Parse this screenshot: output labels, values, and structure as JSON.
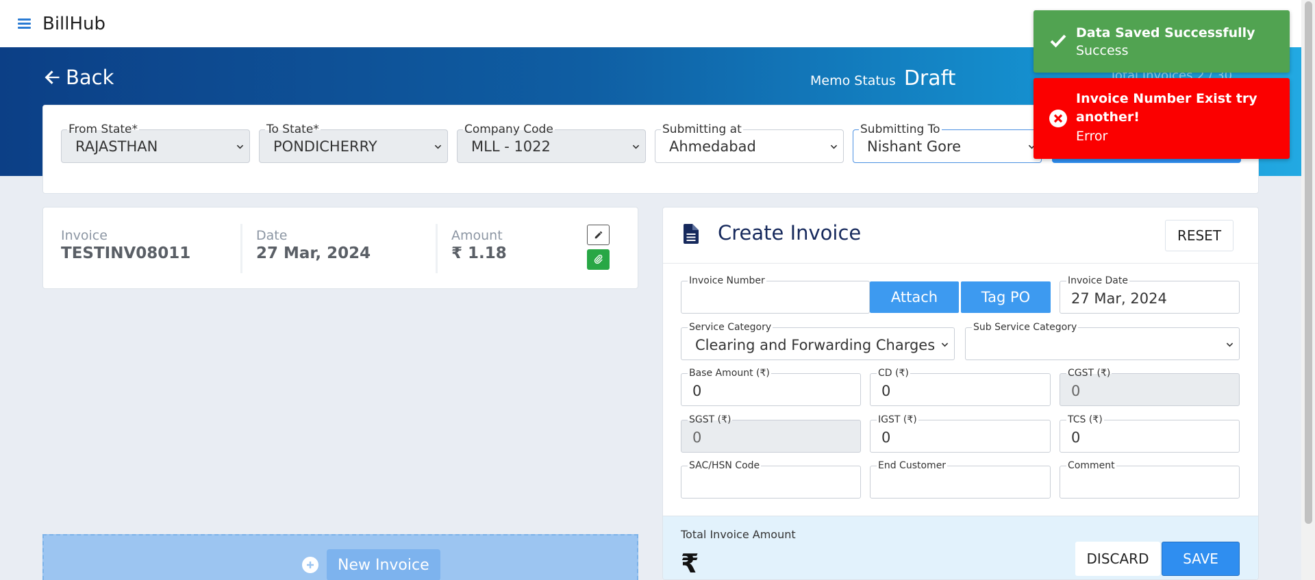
{
  "app": {
    "brand": "BillHub"
  },
  "banner": {
    "back_label": "Back",
    "memo_status_label": "Memo Status",
    "memo_status_value": "Draft",
    "total_ghost": "Total Invoices 2 / 30"
  },
  "header": {
    "from_state": {
      "label": "From State*",
      "value": "RAJASTHAN"
    },
    "to_state": {
      "label": "To State*",
      "value": "PONDICHERRY"
    },
    "company_code": {
      "label": "Company Code",
      "value": "MLL - 1022"
    },
    "submitting_at": {
      "label": "Submitting at",
      "value": "Ahmedabad"
    },
    "submitting_to": {
      "label": "Submitting To",
      "value": "Nishant Gore"
    }
  },
  "invoice_list": {
    "items": [
      {
        "invoice_label": "Invoice",
        "invoice_value": "TESTINV08011",
        "date_label": "Date",
        "date_value": "27 Mar, 2024",
        "amount_label": "Amount",
        "amount_value": "₹ 1.18"
      }
    ],
    "new_invoice_label": "New Invoice"
  },
  "create_invoice": {
    "title": "Create Invoice",
    "reset_label": "RESET",
    "invoice_number": {
      "label": "Invoice Number",
      "value": ""
    },
    "attach_label": "Attach",
    "tag_po_label": "Tag PO",
    "invoice_date": {
      "label": "Invoice Date",
      "value": "27 Mar, 2024"
    },
    "service_category": {
      "label": "Service Category",
      "value": "Clearing and Forwarding Charges"
    },
    "sub_service_category": {
      "label": "Sub Service Category",
      "value": ""
    },
    "base_amount": {
      "label": "Base Amount (₹)",
      "value": "0"
    },
    "cd": {
      "label": "CD (₹)",
      "value": "0"
    },
    "cgst": {
      "label": "CGST (₹)",
      "value": "0"
    },
    "sgst": {
      "label": "SGST (₹)",
      "value": "0"
    },
    "igst": {
      "label": "IGST (₹)",
      "value": "0"
    },
    "tcs": {
      "label": "TCS (₹)",
      "value": "0"
    },
    "sac_hsn": {
      "label": "SAC/HSN Code",
      "value": ""
    },
    "end_customer": {
      "label": "End Customer",
      "value": ""
    },
    "comment": {
      "label": "Comment",
      "value": ""
    },
    "total_label": "Total Invoice Amount",
    "total_symbol": "₹",
    "discard_label": "DISCARD",
    "save_label": "SAVE"
  },
  "toasts": {
    "success": {
      "title": "Data Saved Successfully",
      "message": "Success",
      "color": "#51a351"
    },
    "error": {
      "title": "Invoice Number Exist try another!",
      "message": "Error",
      "color": "#fb0000"
    }
  }
}
